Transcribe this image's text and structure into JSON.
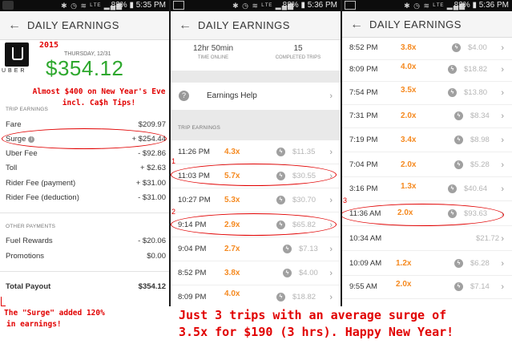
{
  "colors": {
    "accent_green": "#2ea82e",
    "surge_orange": "#f5891f",
    "annotation_red": "#e10000"
  },
  "panels": [
    {
      "status": {
        "battery": "83%",
        "time": "5:35 PM",
        "icons": "✱ ◷ ≋ ᴸᵀᴱ ▂▄▆"
      },
      "header": {
        "back": "←",
        "title": "DAILY EARNINGS"
      }
    },
    {
      "status": {
        "battery": "82%",
        "time": "5:36 PM",
        "icons": "✱ ◷ ≋ ᴸᵀᴱ ▂▄▆"
      },
      "header": {
        "back": "←",
        "title": "DAILY EARNINGS"
      }
    },
    {
      "status": {
        "battery": "82%",
        "time": "5:36 PM",
        "icons": "✱ ◷ ≋ ᴸᵀᴱ ▂▄▆"
      },
      "header": {
        "back": "←",
        "title": "DAILY EARNINGS"
      }
    }
  ],
  "summary": {
    "logo_text": "UBER",
    "year": "2015",
    "date": "THURSDAY, 12/31",
    "amount": "$354.12",
    "note": "Almost $400 on New Year's Eve incl. Ca$h Tips!",
    "trip_earnings_label": "TRIP EARNINGS",
    "rows": [
      {
        "label": "Fare",
        "value": "$209.97"
      },
      {
        "label": "Surge",
        "value": "+ $254.44"
      },
      {
        "label": "Uber Fee",
        "value": "- $92.86"
      },
      {
        "label": "Toll",
        "value": "+ $2.63"
      },
      {
        "label": "Rider Fee (payment)",
        "value": "+ $31.00"
      },
      {
        "label": "Rider Fee (deduction)",
        "value": "- $31.00"
      }
    ],
    "other_payments_label": "OTHER PAYMENTS",
    "other_rows": [
      {
        "label": "Fuel Rewards",
        "value": "- $20.06"
      },
      {
        "label": "Promotions",
        "value": "$0.00"
      }
    ],
    "total_label": "Total Payout",
    "total_value": "$354.12",
    "bottom_note_1": "The \"Surge\" added 120%",
    "bottom_note_2": "in earnings!"
  },
  "middle": {
    "time_online": "12hr 50min",
    "time_online_label": "TIME ONLINE",
    "trips": "15",
    "trips_label": "COMPLETED TRIPS",
    "help": "Earnings Help",
    "trip_earnings_label": "TRIP EARNINGS",
    "trips_list": [
      {
        "time": "11:26 PM",
        "surge": "4.3x",
        "amount": "$11.35"
      },
      {
        "time": "11:03 PM",
        "surge": "5.7x",
        "amount": "$30.55"
      },
      {
        "time": "10:27 PM",
        "surge": "5.3x",
        "amount": "$30.70"
      },
      {
        "time": "9:14 PM",
        "surge": "2.9x",
        "amount": "$65.82"
      },
      {
        "time": "9:04 PM",
        "surge": "2.7x",
        "amount": "$7.13"
      },
      {
        "time": "8:52 PM",
        "surge": "3.8x",
        "amount": "$4.00"
      },
      {
        "time": "8:09 PM",
        "surge": "4.0x",
        "amount": "$18.82"
      }
    ],
    "marker_1": "1",
    "marker_2": "2"
  },
  "right": {
    "trips_list": [
      {
        "time": "8:52 PM",
        "surge": "3.8x",
        "amount": "$4.00"
      },
      {
        "time": "8:09 PM",
        "surge": "4.0x",
        "amount": "$18.82"
      },
      {
        "time": "7:54 PM",
        "surge": "3.5x",
        "amount": "$13.80"
      },
      {
        "time": "7:31 PM",
        "surge": "2.0x",
        "amount": "$8.34"
      },
      {
        "time": "7:19 PM",
        "surge": "3.4x",
        "amount": "$8.98"
      },
      {
        "time": "7:04 PM",
        "surge": "2.0x",
        "amount": "$5.28"
      },
      {
        "time": "3:16 PM",
        "surge": "1.3x",
        "amount": "$40.64"
      },
      {
        "time": "11:36 AM",
        "surge": "2.0x",
        "amount": "$93.63"
      },
      {
        "time": "10:34 AM",
        "surge": "",
        "amount": "$21.72"
      },
      {
        "time": "10:09 AM",
        "surge": "1.2x",
        "amount": "$6.28"
      },
      {
        "time": "9:55 AM",
        "surge": "2.0x",
        "amount": "$7.14"
      }
    ],
    "marker_3": "3"
  },
  "footer_note": {
    "line1": "Just 3 trips with an average surge of",
    "line2": "3.5x for $190 (3 hrs). Happy New Year!"
  }
}
